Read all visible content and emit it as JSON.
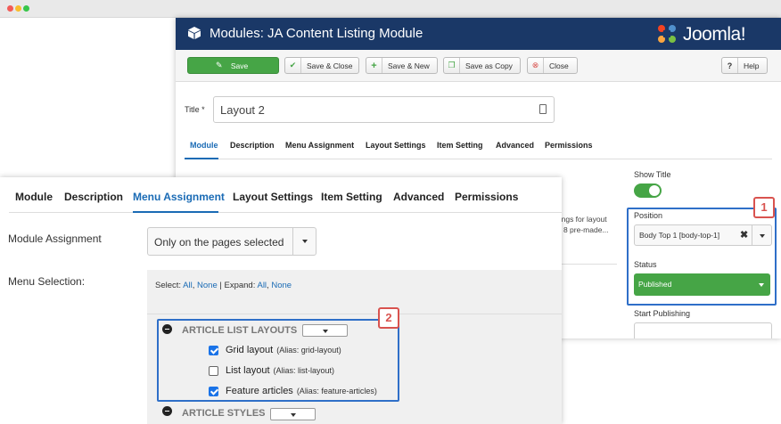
{
  "window": {
    "title": "Modules: JA Content Listing Module",
    "logo_text": "Joomla!"
  },
  "toolbar": {
    "save": "Save",
    "save_close": "Save & Close",
    "save_new": "Save & New",
    "save_copy": "Save as Copy",
    "close": "Close",
    "help": "Help"
  },
  "form": {
    "title_label": "Title *",
    "title_value": "Layout 2"
  },
  "back_tabs": [
    "Module",
    "Description",
    "Menu Assignment",
    "Layout Settings",
    "Item Setting",
    "Advanced",
    "Permissions"
  ],
  "side": {
    "show_title": "Show Title",
    "position_label": "Position",
    "position_value": "Body Top 1 [body-top-1]",
    "position_clear": "✖",
    "status_label": "Status",
    "status_value": "Published",
    "start_label": "Start Publishing"
  },
  "snippet": {
    "line1": "ttings for layout",
    "line2": "s: 8 pre-made..."
  },
  "callouts": {
    "one": "1",
    "two": "2"
  },
  "front_tabs": [
    "Module",
    "Description",
    "Menu Assignment",
    "Layout Settings",
    "Item Setting",
    "Advanced",
    "Permissions"
  ],
  "assignment": {
    "label": "Module Assignment",
    "value": "Only on the pages selected"
  },
  "menu_selection": {
    "label": "Menu Selection:",
    "select_prefix": "Select:",
    "all": "All",
    "none": "None",
    "expand_prefix": "Expand:",
    "expand_all": "All",
    "expand_none": "None"
  },
  "groups": [
    {
      "title": "ARTICLE LIST LAYOUTS",
      "items": [
        {
          "label": "Grid layout",
          "alias": "(Alias: grid-layout)",
          "checked": true
        },
        {
          "label": "List layout",
          "alias": "(Alias: list-layout)",
          "checked": false
        },
        {
          "label": "Feature articles",
          "alias": "(Alias: feature-articles)",
          "checked": true
        }
      ]
    },
    {
      "title": "ARTICLE STYLES",
      "items": []
    }
  ],
  "colors": {
    "header": "#1a3867",
    "green": "#46a546",
    "link": "#1a6bb5",
    "callout": "#2f6fc8",
    "badge": "#d9534f"
  }
}
